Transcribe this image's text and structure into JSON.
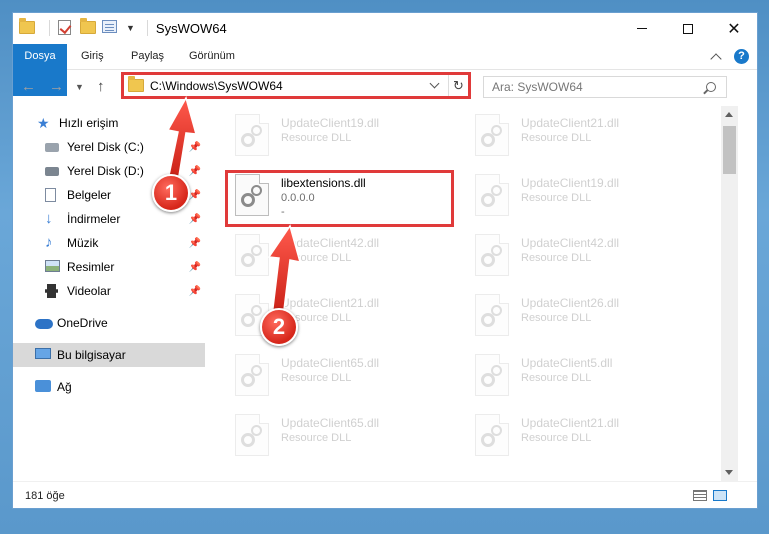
{
  "window": {
    "title": "SysWOW64",
    "controls": {
      "minimize": "—",
      "maximize": "☐",
      "close": "✕"
    }
  },
  "ribbon": {
    "tabs": [
      {
        "label": "Dosya",
        "active": true
      },
      {
        "label": "Giriş"
      },
      {
        "label": "Paylaş"
      },
      {
        "label": "Görünüm"
      }
    ],
    "help": "?"
  },
  "address": {
    "path": "C:\\Windows\\SysWOW64",
    "search_placeholder": "Ara: SysWOW64"
  },
  "sidebar": {
    "items": [
      {
        "label": "Hızlı erişim",
        "icon": "star-icon"
      },
      {
        "label": "Yerel Disk (C:)",
        "icon": "drive-icon",
        "pinned": true
      },
      {
        "label": "Yerel Disk (D:)",
        "icon": "drive-icon",
        "pinned": true
      },
      {
        "label": "Belgeler",
        "icon": "documents-icon",
        "pinned": true
      },
      {
        "label": "İndirmeler",
        "icon": "download-icon",
        "pinned": true
      },
      {
        "label": "Müzik",
        "icon": "music-icon",
        "pinned": true
      },
      {
        "label": "Resimler",
        "icon": "pictures-icon",
        "pinned": true
      },
      {
        "label": "Videolar",
        "icon": "video-icon",
        "pinned": true
      },
      {
        "label": "OneDrive",
        "icon": "cloud-icon"
      },
      {
        "label": "Bu bilgisayar",
        "icon": "computer-icon",
        "selected": true
      },
      {
        "label": "Ağ",
        "icon": "network-icon"
      }
    ]
  },
  "files": {
    "highlighted": {
      "name": "libextensions.dll",
      "version": "0.0.0.0",
      "extra": "-"
    },
    "left_column": [
      {
        "name": "UpdateClient19.dll",
        "desc": "Resource DLL"
      },
      {
        "name": "UpdateClient42.dll",
        "desc": "Resource DLL"
      },
      {
        "name": "UpdateClient21.dll",
        "desc": "Resource DLL"
      },
      {
        "name": "UpdateClient65.dll",
        "desc": "Resource DLL"
      },
      {
        "name": "UpdateClient65.dll",
        "desc": "Resource DLL"
      }
    ],
    "right_column": [
      {
        "name": "UpdateClient21.dll",
        "desc": "Resource DLL"
      },
      {
        "name": "UpdateClient19.dll",
        "desc": "Resource DLL"
      },
      {
        "name": "UpdateClient42.dll",
        "desc": "Resource DLL"
      },
      {
        "name": "UpdateClient26.dll",
        "desc": "Resource DLL"
      },
      {
        "name": "UpdateClient5.dll",
        "desc": "Resource DLL"
      },
      {
        "name": "UpdateClient21.dll",
        "desc": "Resource DLL"
      }
    ]
  },
  "status": {
    "item_count": "181 öğe"
  },
  "callouts": {
    "step1": "1",
    "step2": "2"
  },
  "colors": {
    "accent": "#1979ca",
    "highlight": "#e03a3a"
  }
}
